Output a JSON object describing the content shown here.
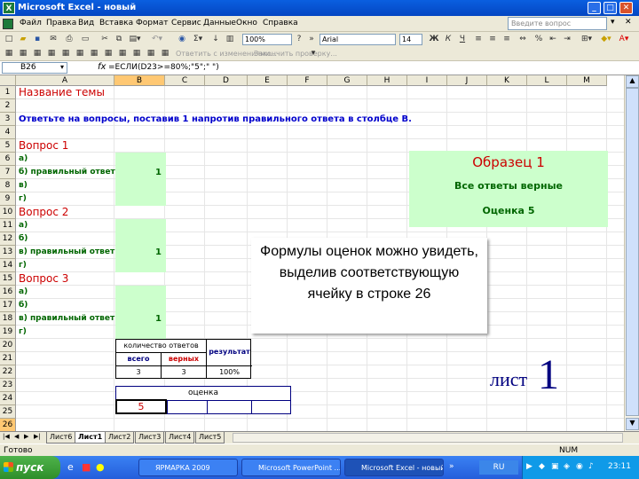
{
  "window": {
    "title": "Microsoft Excel - новый",
    "icon": "excel-icon"
  },
  "menu": [
    "Файл",
    "Правка",
    "Вид",
    "Вставка",
    "Формат",
    "Сервис",
    "Данные",
    "Окно",
    "Справка"
  ],
  "ask_placeholder": "Введите вопрос",
  "toolbar": {
    "zoom": "100%",
    "font": "Arial",
    "font_size": "14"
  },
  "review_toolbar": {
    "reply": "Ответить с изменениями...",
    "end_review": "Закончить проверку..."
  },
  "formula_bar": {
    "name_box": "B26",
    "fx": "fx",
    "formula": "=ЕСЛИ(D23>=80%;\"5\";\" \")"
  },
  "columns": [
    "A",
    "B",
    "C",
    "D",
    "E",
    "F",
    "G",
    "H",
    "I",
    "J",
    "K",
    "L",
    "M"
  ],
  "rows": [
    "1",
    "2",
    "3",
    "4",
    "5",
    "6",
    "7",
    "8",
    "9",
    "10",
    "11",
    "12",
    "13",
    "14",
    "15",
    "16",
    "17",
    "18",
    "19",
    "20",
    "21",
    "22",
    "23",
    "24",
    "25",
    "26"
  ],
  "cells": {
    "r1": "Название темы",
    "r3": "Ответьте на вопросы, поставив 1 напротив правильного ответа в столбце В.",
    "q1": "Вопрос 1",
    "r6": "а)",
    "r7": "б) правильный ответ",
    "b7": "1",
    "r8": "в)",
    "r9": "г)",
    "q2": "Вопрос 2",
    "r11": "а)",
    "r12": "б)",
    "r13": "в) правильный ответ",
    "b13": "1",
    "r14": "г)",
    "q3": "Вопрос 3",
    "r16": "а)",
    "r17": "б)",
    "r18": "в) правильный ответ",
    "b18": "1",
    "r19": "г)"
  },
  "results_table": {
    "answers_count": "количество ответов",
    "result": "результат",
    "total_label": "всего",
    "correct_label": "верных",
    "total": "3",
    "correct": "3",
    "percent": "100%",
    "grade_label": "оценка",
    "grade": "5"
  },
  "sample_box": {
    "title": "Образец 1",
    "line1": "Все ответы верные",
    "line2": "Оценка 5"
  },
  "note": "Формулы оценок можно увидеть, выделив соответствующую ячейку в строке 26",
  "sheet_label": {
    "text": "лист",
    "number": "1"
  },
  "sheet_tabs": [
    "Лист6",
    "Лист1",
    "Лист2",
    "Лист3",
    "Лист4",
    "Лист5"
  ],
  "active_sheet": "Лист1",
  "status": {
    "ready": "Готово",
    "num": "NUM"
  },
  "taskbar": {
    "start": "пуск",
    "tasks": [
      "ЯРМАРКА 2009",
      "Microsoft PowerPoint ...",
      "Microsoft Excel - новый"
    ],
    "lang": "RU",
    "clock": "23:11"
  },
  "colors": {
    "green_fill": "#ccffcc",
    "heading_red": "#cc0000",
    "instruction_blue": "#0000cc",
    "table_border": "#000080"
  }
}
